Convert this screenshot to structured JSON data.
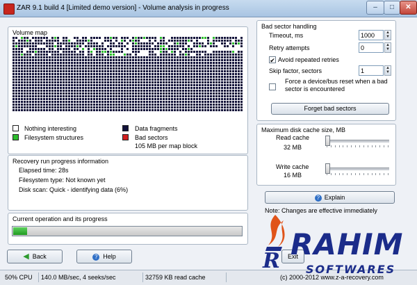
{
  "window": {
    "title": "ZAR 9.1 build 4 [Limited demo version] - Volume analysis in progress",
    "controls": {
      "minimize": "–",
      "maximize": "□",
      "close": "✕"
    }
  },
  "volume_map": {
    "title": "Volume map",
    "colors": {
      "empty": "#ffffff",
      "fragment": "#12123a",
      "structure": "#2dbd2d",
      "bad": "#d21f1f"
    },
    "legend": [
      {
        "label": "Nothing interesting",
        "color": "#ffffff"
      },
      {
        "label": "Filesystem structures",
        "color": "#2dbd2d"
      },
      {
        "label": "Data fragments",
        "color": "#12123a"
      },
      {
        "label": "Bad sectors",
        "color": "#d21f1f"
      }
    ],
    "block_size_note": "105 MB per map block"
  },
  "recovery_progress": {
    "title": "Recovery run progress information",
    "elapsed": "Elapsed time: 28s",
    "fs_type": "Filesystem type: Not known yet",
    "disk_scan": "Disk scan: Quick - identifying data (6%)"
  },
  "current_operation": {
    "title": "Current operation and its progress",
    "progress_fraction": 0.06
  },
  "bad_sector": {
    "title": "Bad sector handling",
    "timeout_label": "Timeout, ms",
    "timeout_value": "1000",
    "retry_label": "Retry attempts",
    "retry_value": "0",
    "avoid_label": "Avoid repeated retries",
    "avoid_checked": "✔",
    "skip_label": "Skip factor, sectors",
    "skip_value": "1",
    "force_label_line1": "Force a device/bus reset when a bad",
    "force_label_line2": "sector is encountered",
    "forget_button": "Forget bad sectors"
  },
  "cache": {
    "title": "Maximum disk cache size, MB",
    "read_label": "Read cache",
    "read_value": "32 MB",
    "write_label": "Write cache",
    "write_value": "16 MB"
  },
  "explain_button": "Explain",
  "note": "Note: Changes are effective immediately",
  "nav": {
    "back": "Back",
    "help": "Help",
    "exit": "Exit"
  },
  "status": {
    "cpu": "50% CPU",
    "throughput": "140.0 MB/sec, 4 seeks/sec",
    "read_cache": "32759 KB read cache",
    "copyright": "(c) 2000-2012 www.z-a-recovery.com"
  },
  "watermark": {
    "brand": "RAHIM",
    "sub": "SOFTWARES"
  },
  "icons": {
    "back": "green-left-arrow-icon",
    "help": "help-icon",
    "explain": "help-icon"
  }
}
